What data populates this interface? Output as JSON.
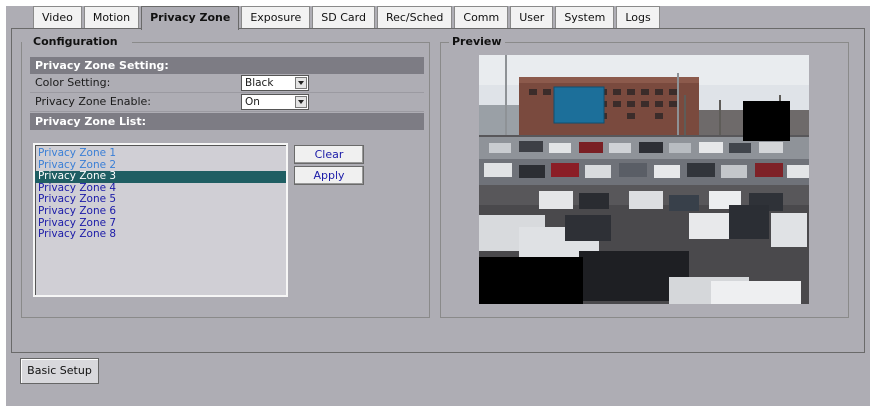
{
  "tabs": [
    {
      "label": "Video",
      "active": false
    },
    {
      "label": "Motion",
      "active": false
    },
    {
      "label": "Privacy Zone",
      "active": true
    },
    {
      "label": "Exposure",
      "active": false
    },
    {
      "label": "SD Card",
      "active": false
    },
    {
      "label": "Rec/Sched",
      "active": false
    },
    {
      "label": "Comm",
      "active": false
    },
    {
      "label": "User",
      "active": false
    },
    {
      "label": "System",
      "active": false
    },
    {
      "label": "Logs",
      "active": false
    }
  ],
  "configuration": {
    "legend": "Configuration",
    "setting_header": "Privacy Zone Setting:",
    "color_label": "Color Setting:",
    "color_value": "Black",
    "enable_label": "Privacy Zone Enable:",
    "enable_value": "On",
    "list_header": "Privacy Zone List:",
    "zones": [
      {
        "label": "Privacy Zone 1",
        "state": "light"
      },
      {
        "label": "Privacy Zone 2",
        "state": "light"
      },
      {
        "label": "Privacy Zone 3",
        "state": "selected"
      },
      {
        "label": "Privacy Zone 4",
        "state": "normal"
      },
      {
        "label": "Privacy Zone 5",
        "state": "normal"
      },
      {
        "label": "Privacy Zone 6",
        "state": "normal"
      },
      {
        "label": "Privacy Zone 7",
        "state": "normal"
      },
      {
        "label": "Privacy Zone 8",
        "state": "normal"
      }
    ],
    "clear_label": "Clear",
    "apply_label": "Apply"
  },
  "preview": {
    "legend": "Preview",
    "zone_blue_color": "#1c6f9a",
    "zone_black_color": "#000000"
  },
  "footer": {
    "basic_setup_label": "Basic Setup"
  }
}
